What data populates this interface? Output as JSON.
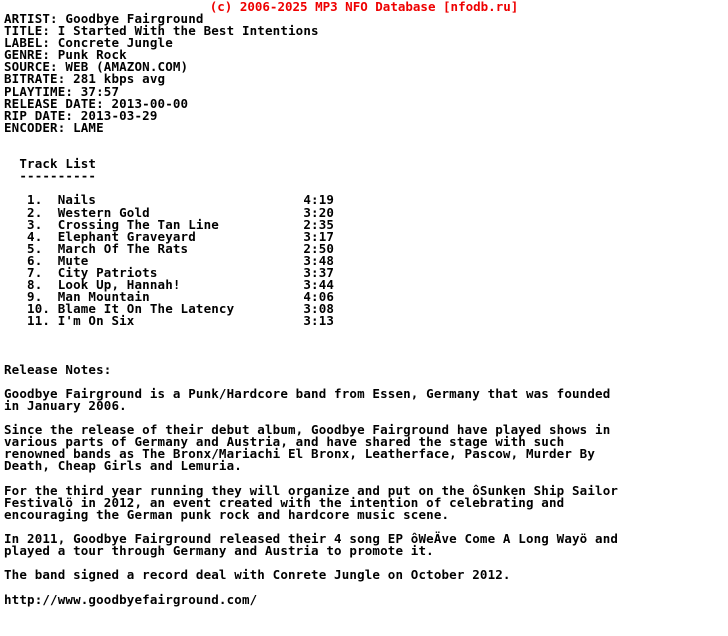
{
  "header": {
    "copyright": "(c) 2006-2025 MP3 NFO Database [nfodb.ru]",
    "color": "#ee0000"
  },
  "metadata": {
    "fields": [
      {
        "label": "ARTIST",
        "value": "Goodbye Fairground"
      },
      {
        "label": "TITLE",
        "value": "I Started With the Best Intentions"
      },
      {
        "label": "LABEL",
        "value": "Concrete Jungle"
      },
      {
        "label": "GENRE",
        "value": "Punk Rock"
      },
      {
        "label": "SOURCE",
        "value": "WEB (AMAZON.COM)"
      },
      {
        "label": "BITRATE",
        "value": "281 kbps avg"
      },
      {
        "label": "PLAYTIME",
        "value": "37:57"
      },
      {
        "label": "RELEASE DATE",
        "value": "2013-00-00"
      },
      {
        "label": "RIP DATE",
        "value": "2013-03-29"
      },
      {
        "label": "ENCODER",
        "value": "LAME"
      }
    ]
  },
  "tracklist": {
    "heading": "Track List",
    "underline": "----------",
    "tracks": [
      {
        "num": "1.",
        "title": "Nails",
        "time": "4:19"
      },
      {
        "num": "2.",
        "title": "Western Gold",
        "time": "3:20"
      },
      {
        "num": "3.",
        "title": "Crossing The Tan Line",
        "time": "2:35"
      },
      {
        "num": "4.",
        "title": "Elephant Graveyard",
        "time": "3:17"
      },
      {
        "num": "5.",
        "title": "March Of The Rats",
        "time": "2:50"
      },
      {
        "num": "6.",
        "title": "Mute",
        "time": "3:48"
      },
      {
        "num": "7.",
        "title": "City Patriots",
        "time": "3:37"
      },
      {
        "num": "8.",
        "title": "Look Up, Hannah!",
        "time": "3:44"
      },
      {
        "num": "9.",
        "title": "Man Mountain",
        "time": "4:06"
      },
      {
        "num": "10.",
        "title": "Blame It On The Latency",
        "time": "3:08"
      },
      {
        "num": "11.",
        "title": "I'm On Six",
        "time": "3:13"
      }
    ]
  },
  "release_notes": {
    "heading": "Release Notes:",
    "paragraphs": [
      [
        "Goodbye Fairground is a Punk/Hardcore band from Essen, Germany that was founded",
        "in January 2006."
      ],
      [
        "Since the release of their debut album, Goodbye Fairground have played shows in",
        "various parts of Germany and Austria, and have shared the stage with such",
        "renowned bands as The Bronx/Mariachi El Bronx, Leatherface, Pascow, Murder By",
        "Death, Cheap Girls and Lemuria."
      ],
      [
        "For the third year running they will organize and put on the ôSunken Ship Sailor",
        "Festivalö in 2012, an event created with the intention of celebrating and",
        "encouraging the German punk rock and hardcore music scene."
      ],
      [
        "In 2011, Goodbye Fairground released their 4 song EP ôWeÄve Come A Long Wayö and",
        "played a tour through Germany and Austria to promote it."
      ],
      [
        "The band signed a record deal with Conrete Jungle on October 2012."
      ]
    ]
  },
  "footer": {
    "url": "http://www.goodbyefairground.com/"
  }
}
